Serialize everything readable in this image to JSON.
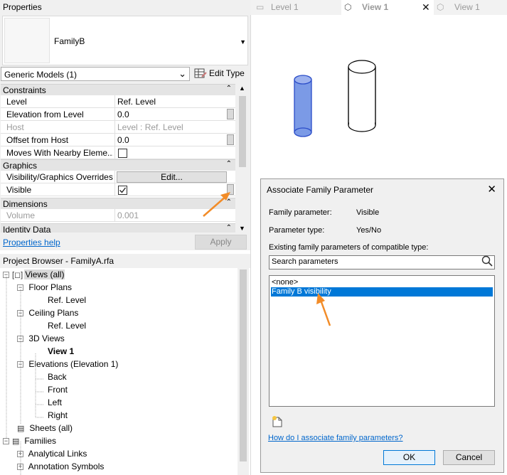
{
  "properties": {
    "title": "Properties",
    "type_name": "FamilyB",
    "category": "Generic Models (1)",
    "edit_type_label": "Edit Type",
    "groups": {
      "constraints": "Constraints",
      "graphics": "Graphics",
      "dimensions": "Dimensions",
      "identity": "Identity Data"
    },
    "rows": {
      "level": {
        "label": "Level",
        "value": "Ref. Level"
      },
      "elevation": {
        "label": "Elevation from Level",
        "value": "0.0"
      },
      "host": {
        "label": "Host",
        "value": "Level : Ref. Level"
      },
      "offset": {
        "label": "Offset from Host",
        "value": "0.0"
      },
      "moves": {
        "label": "Moves With Nearby Eleme...",
        "checked": false
      },
      "vis_overrides": {
        "label": "Visibility/Graphics Overrides",
        "button": "Edit..."
      },
      "visible": {
        "label": "Visible",
        "checked": true
      },
      "volume": {
        "label": "Volume",
        "value": "0.001"
      }
    },
    "help_link": "Properties help",
    "apply_label": "Apply"
  },
  "browser": {
    "title": "Project Browser - FamilyA.rfa",
    "nodes": {
      "views": "Views (all)",
      "floor_plans": "Floor Plans",
      "fp_ref": "Ref. Level",
      "ceiling_plans": "Ceiling Plans",
      "cp_ref": "Ref. Level",
      "views_3d": "3D Views",
      "view1": "View 1",
      "elevations": "Elevations (Elevation 1)",
      "back": "Back",
      "front": "Front",
      "left": "Left",
      "right": "Right",
      "sheets": "Sheets (all)",
      "families": "Families",
      "analytical": "Analytical Links",
      "annotation": "Annotation Symbols"
    }
  },
  "tabs": [
    {
      "label": "Level 1"
    },
    {
      "label": "View 1"
    },
    {
      "label": "View 1"
    }
  ],
  "dialog": {
    "title": "Associate Family Parameter",
    "family_parameter_label": "Family parameter:",
    "family_parameter_value": "Visible",
    "parameter_type_label": "Parameter type:",
    "parameter_type_value": "Yes/No",
    "existing_label": "Existing family parameters of compatible type:",
    "search_placeholder": "Search parameters",
    "items": [
      "<none>",
      "Family B visibility"
    ],
    "selected_index": 1,
    "help_link": "How do I associate family parameters?",
    "ok_label": "OK",
    "cancel_label": "Cancel"
  },
  "colors": {
    "accent": "#0078d7",
    "annotation_arrow": "#f28c28",
    "selected_cylinder": "#7b9ae6"
  }
}
